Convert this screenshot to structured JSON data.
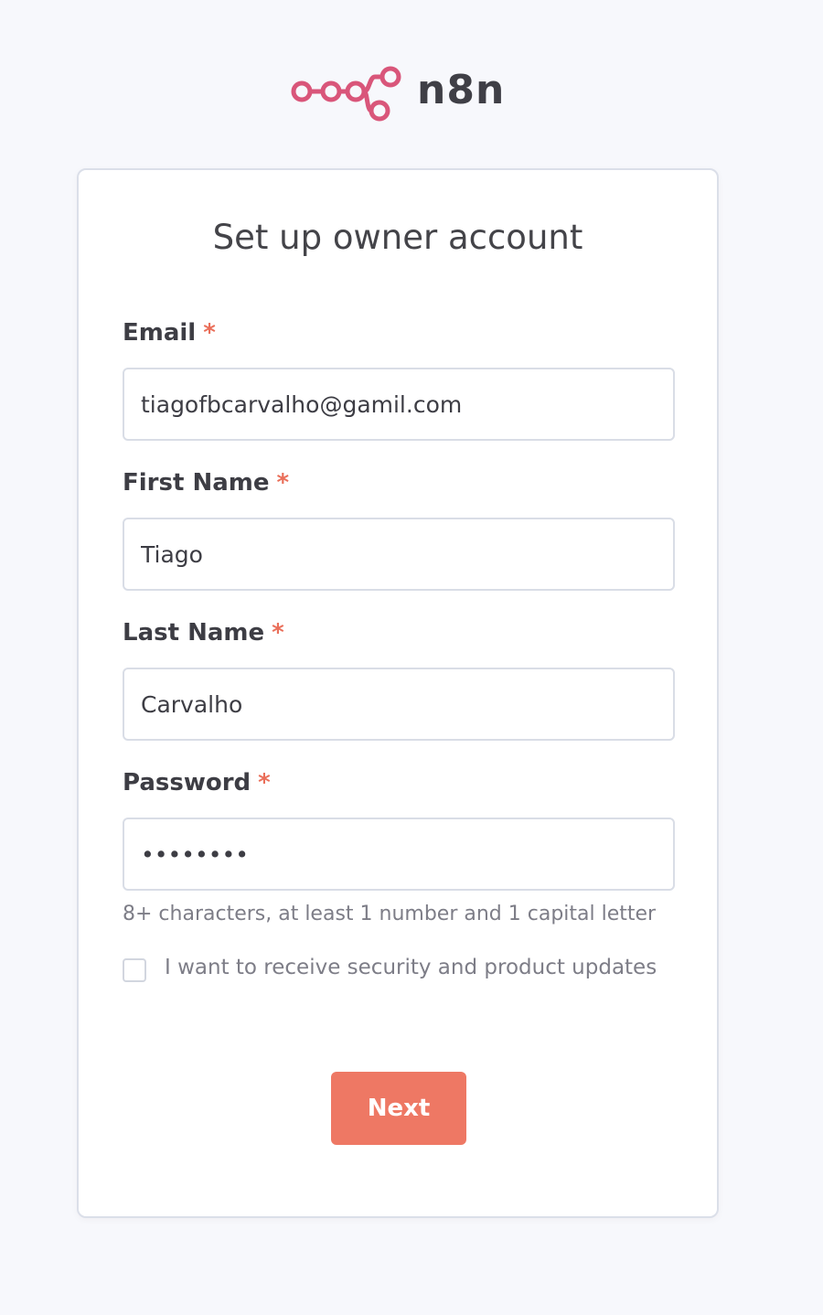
{
  "brand": {
    "name": "n8n",
    "logo_icon": "n8n-node-graph-icon",
    "logo_color": "#d9567a"
  },
  "form": {
    "title": "Set up owner account",
    "required_marker": "*",
    "email": {
      "label": "Email",
      "value": "tiagofbcarvalho@gamil.com"
    },
    "first_name": {
      "label": "First Name",
      "value": "Tiago"
    },
    "last_name": {
      "label": "Last Name",
      "value": "Carvalho"
    },
    "password": {
      "label": "Password",
      "value": "••••••••",
      "hint": "8+ characters, at least 1 number and 1 capital letter"
    },
    "updates_checkbox": {
      "label": "I want to receive security and product updates",
      "checked": false
    },
    "submit_label": "Next"
  },
  "colors": {
    "accent": "#ee7864",
    "required": "#ea6f5a",
    "background": "#f7f8fc"
  }
}
